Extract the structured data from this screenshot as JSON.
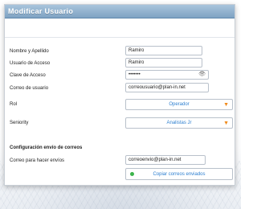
{
  "title": "Modificar Usuario",
  "fields": {
    "nombre": {
      "label": "Nombre y Apellido",
      "value": "Ramiro"
    },
    "usuario": {
      "label": "Usuario de Acceso",
      "value": "Ramiro"
    },
    "clave": {
      "label": "Clave de Acceso",
      "value": "•••••••"
    },
    "correo": {
      "label": "Correo de usuario",
      "value": "correousuario@plan-in.net"
    },
    "rol": {
      "label": "Rol",
      "selected": "Operador"
    },
    "seniority": {
      "label": "Seniority",
      "selected": "Analistas Jr"
    }
  },
  "email_config": {
    "section_title": "Configuración envío de correos",
    "envio": {
      "label": "Correo para hacer envíos",
      "value": "correoenvio@plan-in.net"
    },
    "copy_button": "Copiar correos enviados",
    "copy_active": true
  },
  "icons": {
    "password_visibility": "eye-icon",
    "dropdown": "caret-down-icon",
    "status": "green-dot-icon"
  },
  "colors": {
    "titlebar": "#8fb0ce",
    "accent_text": "#2d7fd0",
    "caret": "#f08a1a",
    "status_green": "#3cb44b"
  }
}
